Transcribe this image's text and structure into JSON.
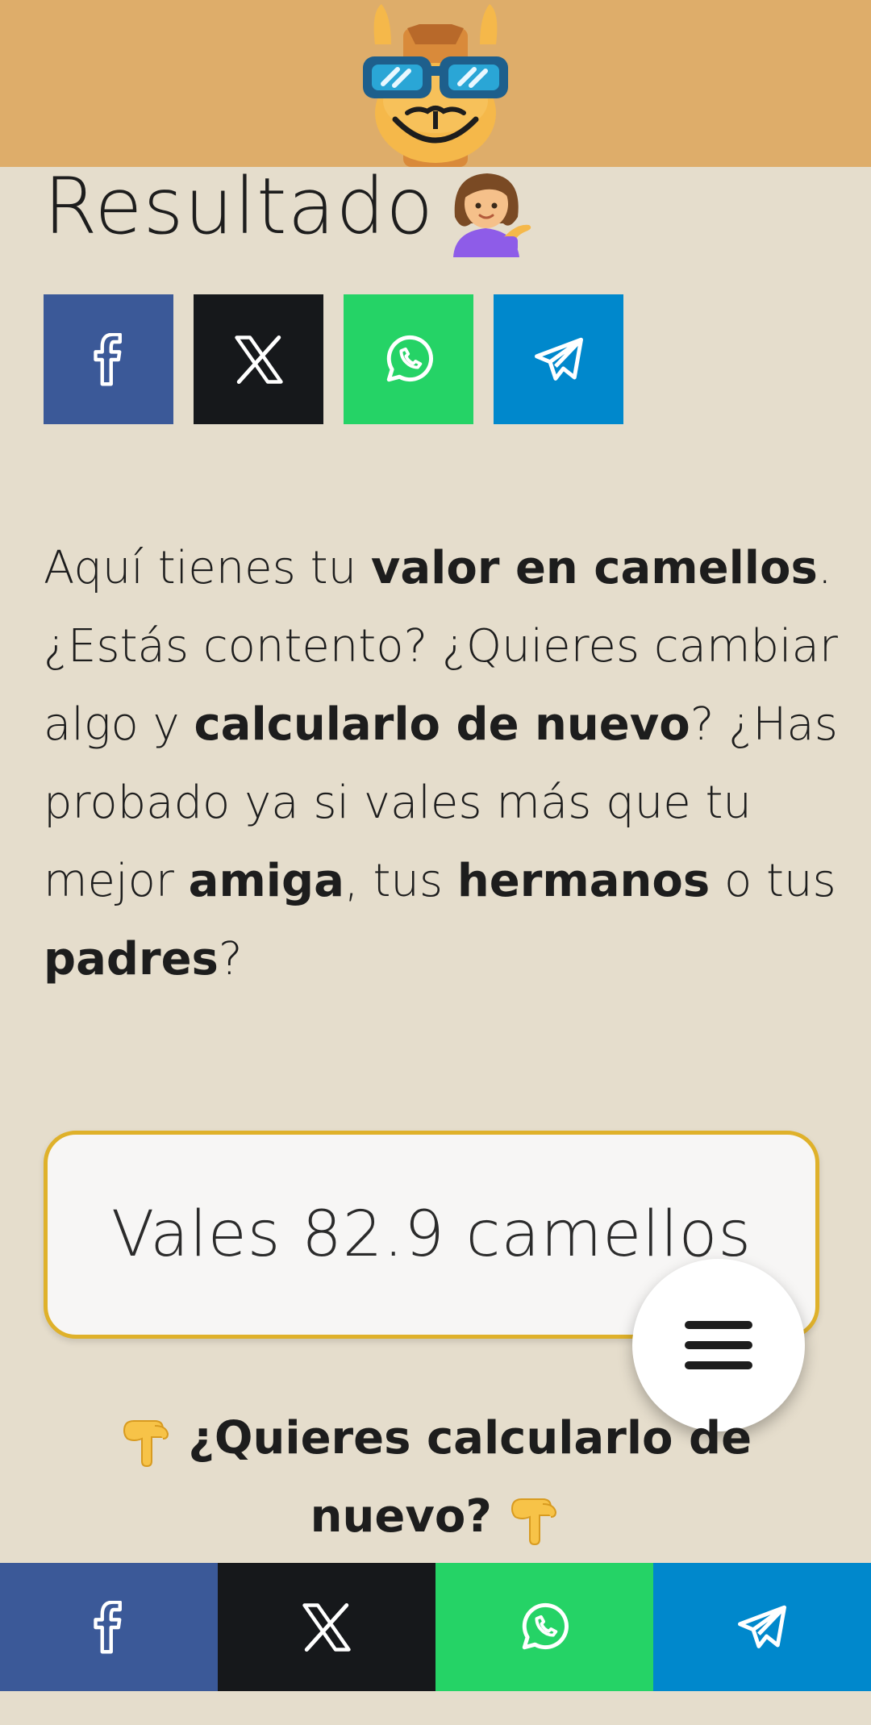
{
  "header": {
    "logo_icon": "camel-sunglasses-logo-icon"
  },
  "title": {
    "text": "Resultado",
    "emoji_icon": "person-tipping-hand-icon"
  },
  "share": {
    "colors": {
      "facebook": "#3b5998",
      "x": "#16181b",
      "whatsapp": "#25d366",
      "telegram": "#0088cc"
    },
    "buttons": [
      {
        "network": "facebook",
        "icon": "facebook-icon"
      },
      {
        "network": "x",
        "icon": "x-icon"
      },
      {
        "network": "whatsapp",
        "icon": "whatsapp-icon"
      },
      {
        "network": "telegram",
        "icon": "telegram-icon"
      }
    ]
  },
  "intro": {
    "t1": "Aquí tienes tu ",
    "b1": "valor en camellos",
    "t2": ". ¿Estás contento? ¿Quieres cambiar algo y ",
    "b2": "calcularlo de nuevo",
    "t3": "? ¿Has probado ya si vales más que tu mejor ",
    "b3": "amiga",
    "t4": ", tus ",
    "b4": "hermanos",
    "t5": " o tus ",
    "b5": "padres",
    "t6": "?"
  },
  "result": {
    "text": "Vales 82.9 camellos",
    "border_color": "#dfb12a"
  },
  "menu": {
    "icon": "hamburger-menu-icon"
  },
  "recalc": {
    "text": "¿Quieres calcularlo de nuevo?",
    "hand_icon": "backhand-index-pointing-down-icon"
  },
  "colors": {
    "header_bg": "#dead6a",
    "page_bg": "#e5ddcc"
  }
}
